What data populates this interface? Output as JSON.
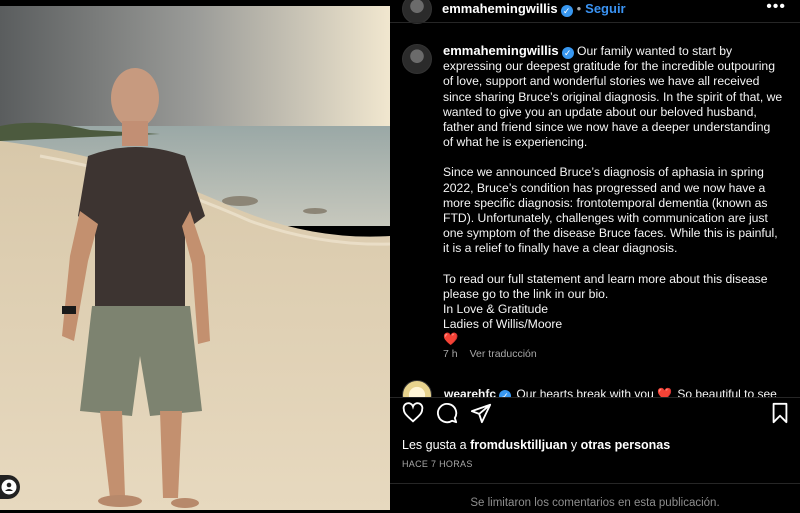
{
  "post": {
    "username": "emmahemingwillis",
    "follow_label": "Seguir",
    "separator": "•",
    "more_label": "•••",
    "caption_paragraphs": [
      "Our family wanted to start by expressing our deepest gratitude for the incredible outpouring of love, support and wonderful stories we have all received since sharing Bruce’s original diagnosis. In the spirit of that, we wanted to give you an update about our beloved husband, father and friend since we now have a deeper understanding of what he is experiencing.",
      "Since we announced Bruce’s diagnosis of aphasia in spring 2022, Bruce’s condition has progressed and we now have a more specific diagnosis: frontotemporal dementia (known as FTD). Unfortunately, challenges with communication are just one symptom of the disease Bruce faces. While this is painful, it is a relief to finally have a clear diagnosis."
    ],
    "caption_end_lines": [
      "To read our full statement and learn more about this disease please go to the link in our bio.",
      "In Love & Gratitude",
      "Ladies of Willis/Moore",
      "❤️"
    ],
    "age": "7 h",
    "translate_label": "Ver traducción"
  },
  "comment": {
    "username": "wearehfc",
    "text": "Our hearts break with you",
    "heart": "❤️",
    "text2": "So beautiful to see"
  },
  "likes": {
    "prefix": "Les gusta a",
    "user": "fromdusktilljuan",
    "connector": "y",
    "rest": "otras personas"
  },
  "timestamp": "HACE 7 HORAS",
  "comments_closed": "Se limitaron los comentarios en esta publicación.",
  "colors": {
    "accent": "#3a93f3",
    "background": "#000000",
    "heart": "#ed4956"
  },
  "icons": [
    "heart-icon",
    "comment-icon",
    "share-icon",
    "bookmark-icon",
    "user-tag-icon",
    "verified-icon"
  ]
}
